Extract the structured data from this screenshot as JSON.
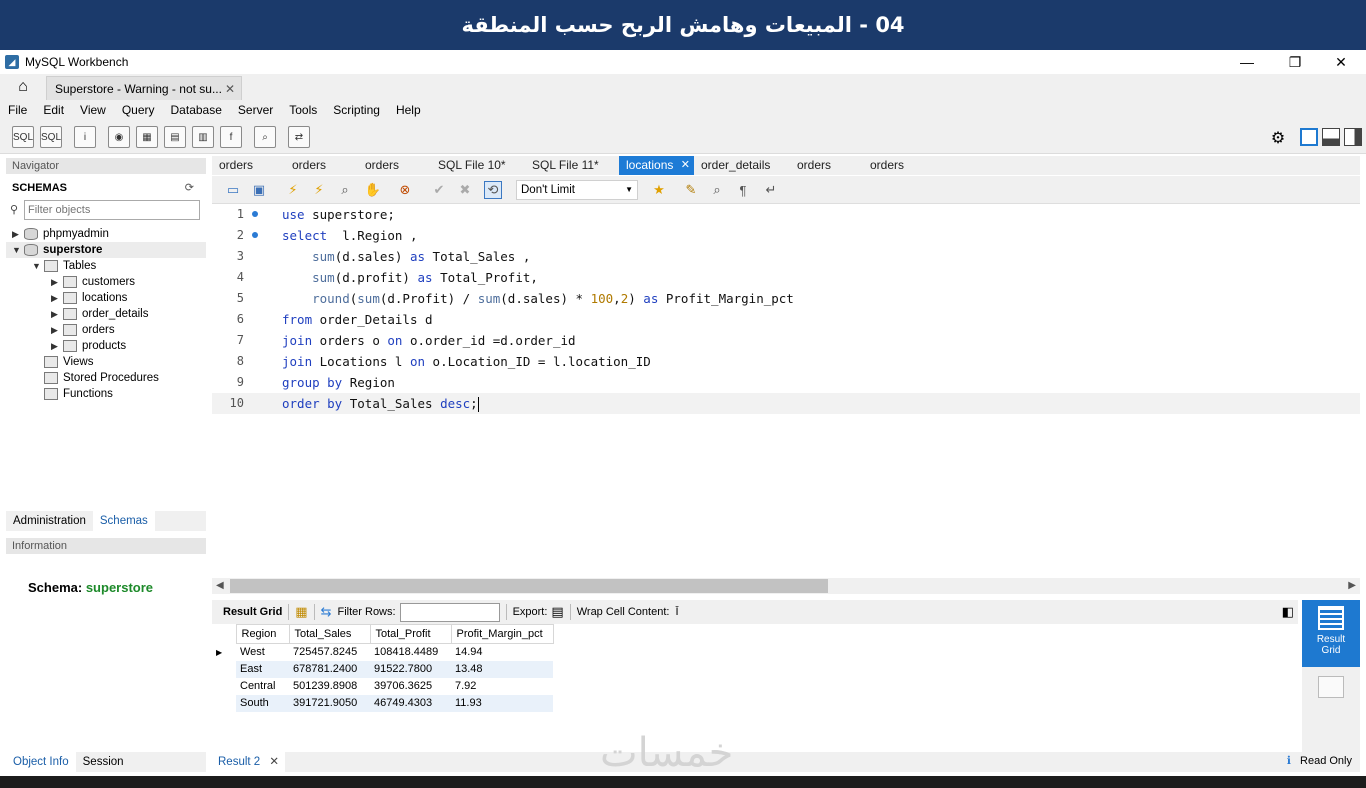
{
  "banner": {
    "title": "04 - المبيعات وهامش الربح حسب المنطقة"
  },
  "window": {
    "title": "MySQL Workbench",
    "minimize": "—",
    "maximize": "❐",
    "close": "✕"
  },
  "connection_tab": {
    "label": "Superstore - Warning - not su...",
    "close": "✕"
  },
  "menu": [
    "File",
    "Edit",
    "View",
    "Query",
    "Database",
    "Server",
    "Tools",
    "Scripting",
    "Help"
  ],
  "navigator": {
    "header": "Navigator",
    "schemas_label": "SCHEMAS",
    "filter_placeholder": "Filter objects",
    "tree": {
      "phpmyadmin": "phpmyadmin",
      "superstore": "superstore",
      "tables": "Tables",
      "table_items": [
        "customers",
        "locations",
        "order_details",
        "orders",
        "products"
      ],
      "views": "Views",
      "stored_procedures": "Stored Procedures",
      "functions": "Functions"
    },
    "tabs": {
      "administration": "Administration",
      "schemas": "Schemas"
    },
    "information_header": "Information",
    "schema_label": "Schema:",
    "schema_value": "superstore",
    "bottom_tabs": {
      "object_info": "Object Info",
      "session": "Session"
    }
  },
  "editor_tabs": [
    "orders",
    "orders",
    "orders",
    "SQL File 10*",
    "SQL File 11*",
    "locations",
    "order_details",
    "orders",
    "orders"
  ],
  "active_editor_tab": 5,
  "editor_toolbar": {
    "limit": "Don't Limit"
  },
  "code_lines": [
    {
      "n": "1",
      "dot": true
    },
    {
      "n": "2",
      "dot": true
    },
    {
      "n": "3",
      "dot": false
    },
    {
      "n": "4",
      "dot": false
    },
    {
      "n": "5",
      "dot": false
    },
    {
      "n": "6",
      "dot": false
    },
    {
      "n": "7",
      "dot": false
    },
    {
      "n": "8",
      "dot": false
    },
    {
      "n": "9",
      "dot": false
    },
    {
      "n": "10",
      "dot": false
    }
  ],
  "code_text": {
    "l1": [
      "use",
      " superstore;"
    ],
    "l2": [
      "select",
      "  l.Region ,"
    ],
    "l3": [
      "    ",
      "sum",
      "(d.sales) ",
      "as",
      " Total_Sales ,"
    ],
    "l4": [
      "    ",
      "sum",
      "(d.profit) ",
      "as",
      " Total_Profit,"
    ],
    "l5": [
      "    ",
      "round",
      "(",
      "sum",
      "(d.Profit) / ",
      "sum",
      "(d.sales) * ",
      "100",
      ",",
      "2",
      ") ",
      "as",
      " Profit_Margin_pct"
    ],
    "l6": [
      "from",
      " order_Details d"
    ],
    "l7": [
      "join",
      " orders o ",
      "on",
      " o.order_id =d.order_id"
    ],
    "l8": [
      "join",
      " Locations l ",
      "on",
      " o.Location_ID = l.location_ID"
    ],
    "l9": [
      "group by",
      " Region"
    ],
    "l10": [
      "order by",
      " Total_Sales ",
      "desc",
      ";"
    ]
  },
  "result_toolbar": {
    "result_grid": "Result Grid",
    "filter_rows": "Filter Rows:",
    "export": "Export:",
    "wrap": "Wrap Cell Content:"
  },
  "result": {
    "columns": [
      "Region",
      "Total_Sales",
      "Total_Profit",
      "Profit_Margin_pct"
    ],
    "rows": [
      [
        "West",
        "725457.8245",
        "108418.4489",
        "14.94"
      ],
      [
        "East",
        "678781.2400",
        "91522.7800",
        "13.48"
      ],
      [
        "Central",
        "501239.8908",
        "39706.3625",
        "7.92"
      ],
      [
        "South",
        "391721.9050",
        "46749.4303",
        "11.93"
      ]
    ]
  },
  "side_panel": {
    "result_grid_line1": "Result",
    "result_grid_line2": "Grid"
  },
  "bottom": {
    "result_tab": "Result 2",
    "close": "✕",
    "read_only": "Read Only"
  },
  "watermark": "خمسات"
}
